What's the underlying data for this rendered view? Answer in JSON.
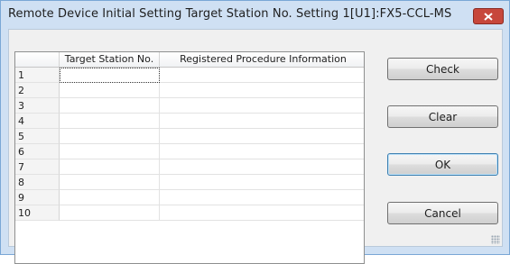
{
  "window": {
    "title": "Remote Device Initial Setting Target Station No. Setting  1[U1]:FX5-CCL-MS",
    "close_icon": "close-icon"
  },
  "grid": {
    "columns": [
      "",
      "Target Station No.",
      "Registered Procedure Information"
    ],
    "rows": [
      {
        "num": "1",
        "target": "",
        "info": ""
      },
      {
        "num": "2",
        "target": "",
        "info": ""
      },
      {
        "num": "3",
        "target": "",
        "info": ""
      },
      {
        "num": "4",
        "target": "",
        "info": ""
      },
      {
        "num": "5",
        "target": "",
        "info": ""
      },
      {
        "num": "6",
        "target": "",
        "info": ""
      },
      {
        "num": "7",
        "target": "",
        "info": ""
      },
      {
        "num": "8",
        "target": "",
        "info": ""
      },
      {
        "num": "9",
        "target": "",
        "info": ""
      },
      {
        "num": "10",
        "target": "",
        "info": ""
      }
    ]
  },
  "buttons": {
    "check": "Check",
    "clear": "Clear",
    "ok": "OK",
    "cancel": "Cancel"
  },
  "colors": {
    "title_bar": "#cfe0f3",
    "close_button": "#c7473b",
    "client_bg": "#f0f0f0"
  }
}
